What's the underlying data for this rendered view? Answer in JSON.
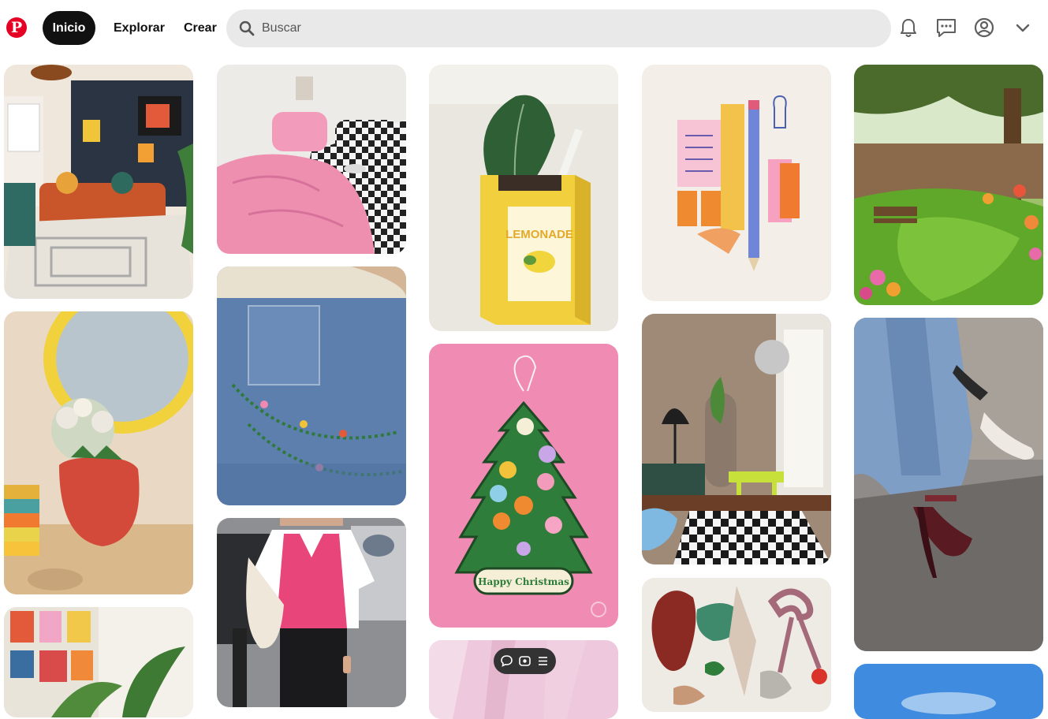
{
  "header": {
    "logo_letter": "P",
    "nav": [
      {
        "label": "Inicio",
        "active": true
      },
      {
        "label": "Explorar",
        "active": false
      },
      {
        "label": "Crear",
        "active": false
      }
    ],
    "search": {
      "placeholder": "Buscar",
      "value": ""
    },
    "icons": [
      "bell-icon",
      "chat-icon",
      "profile-icon",
      "chevron-down-icon"
    ]
  },
  "colors": {
    "brand": "#e60023",
    "active_pill": "#111111",
    "search_bg": "#e9e9e9"
  },
  "pins": [
    {
      "name": "pin-living-room",
      "column": 1,
      "description": "colorful living room with orange sofa and maze rug"
    },
    {
      "name": "pin-strawberry-vase",
      "column": 1,
      "description": "strawberry vase with flowers under yellow mirror"
    },
    {
      "name": "pin-gallery-wall",
      "column": 1,
      "description": "gallery wall with posters and monstera"
    },
    {
      "name": "pin-pink-bed",
      "column": 2,
      "description": "pink bedding on checkered bed"
    },
    {
      "name": "pin-jeans-beads",
      "column": 2,
      "description": "jeans with beaded chain"
    },
    {
      "name": "pin-pink-vest",
      "column": 2,
      "description": "person wearing pink knit vest"
    },
    {
      "name": "pin-lemonade-planter",
      "column": 3,
      "description": "lemonade carton planter"
    },
    {
      "name": "pin-christmas-tree",
      "column": 3,
      "description": "Happy Christmas air freshener tree"
    },
    {
      "name": "pin-pink-curtain",
      "column": 3,
      "description": "pink curtain"
    },
    {
      "name": "pin-stationery",
      "column": 4,
      "description": "stationery illustration"
    },
    {
      "name": "pin-disco-room",
      "column": 4,
      "description": "room with disco ball and checkered rug"
    },
    {
      "name": "pin-curiosities",
      "column": 4,
      "description": "heart, shells and bow stickers"
    },
    {
      "name": "pin-garden",
      "column": 5,
      "description": "sunny garden with bench and flowers"
    },
    {
      "name": "pin-heels",
      "column": 5,
      "description": "burgundy heels and jeans"
    },
    {
      "name": "pin-sky",
      "column": 5,
      "description": "blue sky"
    }
  ],
  "christmas_tree": {
    "banner": "Happy Christmas"
  },
  "overlay_toolbar": {
    "icons": [
      "comment-icon",
      "view-icon",
      "menu-icon"
    ]
  }
}
